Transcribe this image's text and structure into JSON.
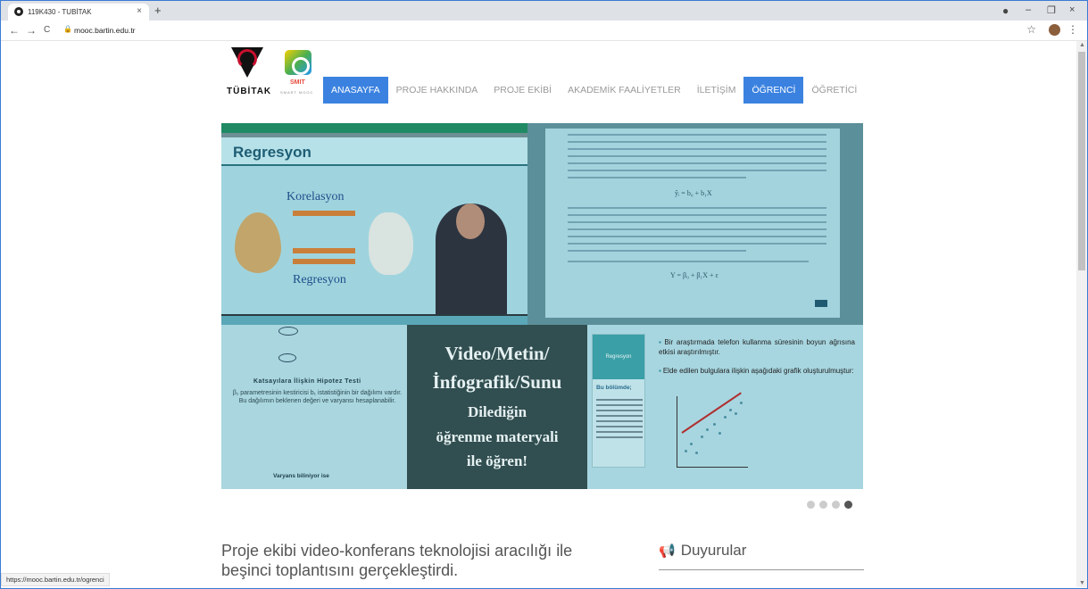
{
  "browser": {
    "tab_title": "119K430 - TUBİTAK",
    "tab_close": "×",
    "new_tab": "+",
    "url": "mooc.bartin.edu.tr",
    "status_url": "https://mooc.bartin.edu.tr/ogrenci",
    "win_min": "–",
    "win_max": "❐",
    "win_close": "×",
    "back": "←",
    "forward": "→",
    "reload": "C",
    "star": "☆",
    "menu": "⋮"
  },
  "logos": {
    "tubitak": "TÜBİTAK",
    "smit": "SMIT",
    "smit_sub": "SMART MOOC"
  },
  "nav": {
    "items": [
      {
        "label": "ANASAYFA",
        "active": true
      },
      {
        "label": "PROJE HAKKINDA",
        "active": false
      },
      {
        "label": "PROJE EKİBİ",
        "active": false
      },
      {
        "label": "AKADEMİK FAALİYETLER",
        "active": false
      },
      {
        "label": "İLETİŞİM",
        "active": false
      },
      {
        "label": "ÖĞRENCİ",
        "active": true
      },
      {
        "label": "ÖĞRETİCİ",
        "active": false
      }
    ]
  },
  "slide": {
    "p1_title": "Regresyon",
    "p1_kor": "Korelasyon",
    "p1_reg": "Regresyon",
    "p2_formula1": "ŷᵢ = b₀ + b₁X",
    "p2_formula2": "Y = β₀ + β₁X + ε",
    "p3_title": "Katsayılara İlişkin Hipotez Testi",
    "p3_body": "β₁ parametresinin kestiricisi b₁ istatistiğinin bir dağılımı vardır. Bu dağılımın beklenen değeri ve varyansı hesaplanabilir.",
    "p3_bottom": "Varyans biliniyor ise",
    "p4_lines": [
      "Video/Metin/",
      "İnfografik/Sunu",
      "Dilediğin",
      "öğrenme materyali",
      "ile öğren!"
    ],
    "p5_side_title": "Regresyon",
    "p5_side_sub": "Bu bölümde;",
    "p5_bullet1": "Bir araştırmada telefon kullanma süresinin boyun ağrısına etkisi araştırılmıştır.",
    "p5_bullet2": "Elde edilen bulgulara ilişkin aşağıdaki grafik oluşturulmuştur:",
    "dots_active_index": 4
  },
  "news": {
    "headline": "Proje ekibi video-konferans teknolojisi aracılığı ile beşinci toplantısını gerçekleştirdi."
  },
  "announcements": {
    "title": "Duyurular"
  },
  "colors": {
    "nav_active": "#3b82e0",
    "nav_inactive": "#9a9a9a"
  }
}
